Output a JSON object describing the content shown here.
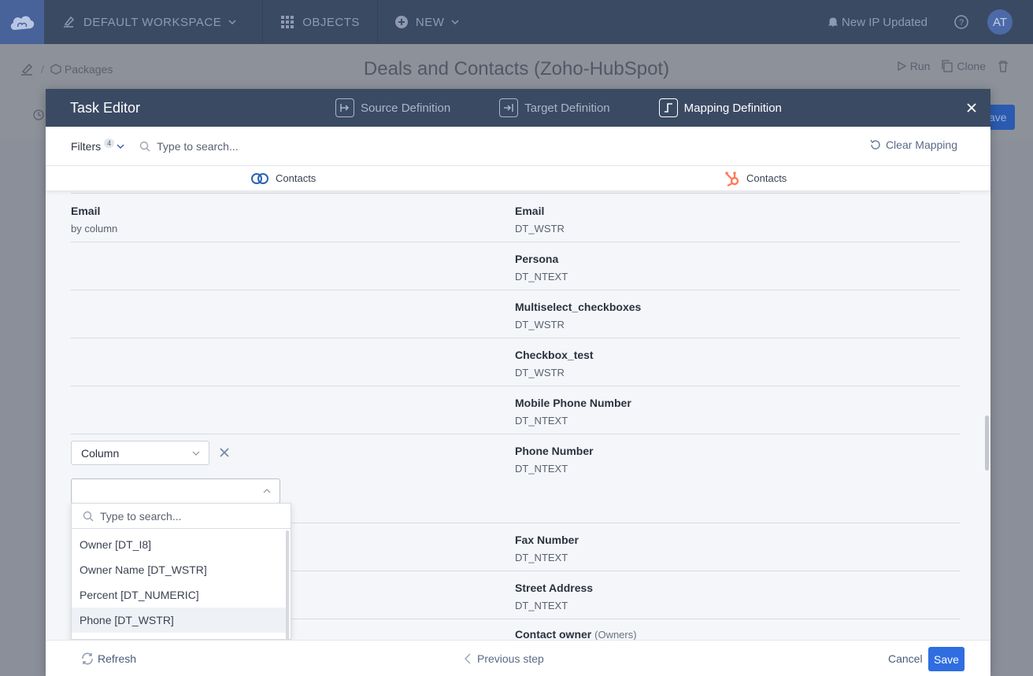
{
  "topbar": {
    "workspace": "DEFAULT WORKSPACE",
    "objects": "OBJECTS",
    "new": "NEW",
    "notification": "New IP Updated",
    "avatar": "AT"
  },
  "page": {
    "breadcrumb": "Packages",
    "title": "Deals and Contacts (Zoho-HubSpot)",
    "run": "Run",
    "clone": "Clone",
    "save_partial": "ave"
  },
  "modal": {
    "title": "Task Editor",
    "steps": [
      {
        "label": "Source Definition",
        "active": false
      },
      {
        "label": "Target Definition",
        "active": false
      },
      {
        "label": "Mapping Definition",
        "active": true
      }
    ],
    "filters_label": "Filters",
    "filters_count": "4",
    "search_placeholder": "Type to search...",
    "clear_mapping": "Clear Mapping",
    "source_conn": "Contacts",
    "target_conn": "Contacts"
  },
  "mapping_rows": [
    {
      "source_name": "Email",
      "source_sub": "by column",
      "target_name": "Email",
      "target_type": "DT_WSTR"
    },
    {
      "target_name": "Persona",
      "target_type": "DT_NTEXT"
    },
    {
      "target_name": "Multiselect_checkboxes",
      "target_type": "DT_WSTR"
    },
    {
      "target_name": "Checkbox_test",
      "target_type": "DT_WSTR"
    },
    {
      "target_name": "Mobile Phone Number",
      "target_type": "DT_NTEXT"
    },
    {
      "target_name": "Phone Number",
      "target_type": "DT_NTEXT"
    },
    {
      "target_name": "Fax Number",
      "target_type": "DT_NTEXT"
    },
    {
      "target_name": "Street Address",
      "target_type": "DT_NTEXT"
    },
    {
      "target_name": "Contact owner",
      "target_extra": "(Owners)"
    }
  ],
  "mapping_editor": {
    "kind_select": "Column",
    "column_select": "",
    "dropdown_search_placeholder": "Type to search...",
    "options": [
      "Owner [DT_I8]",
      "Owner Name [DT_WSTR]",
      "Percent [DT_NUMERIC]",
      "Phone [DT_WSTR]"
    ],
    "highlighted": "Phone [DT_WSTR]"
  },
  "footer": {
    "refresh": "Refresh",
    "previous": "Previous step",
    "cancel": "Cancel",
    "save": "Save"
  },
  "colors": {
    "header_bg": "#3b4a63",
    "primary": "#2f6de0",
    "hubspot": "#ff7a59",
    "zoho": "#2a64b5"
  }
}
